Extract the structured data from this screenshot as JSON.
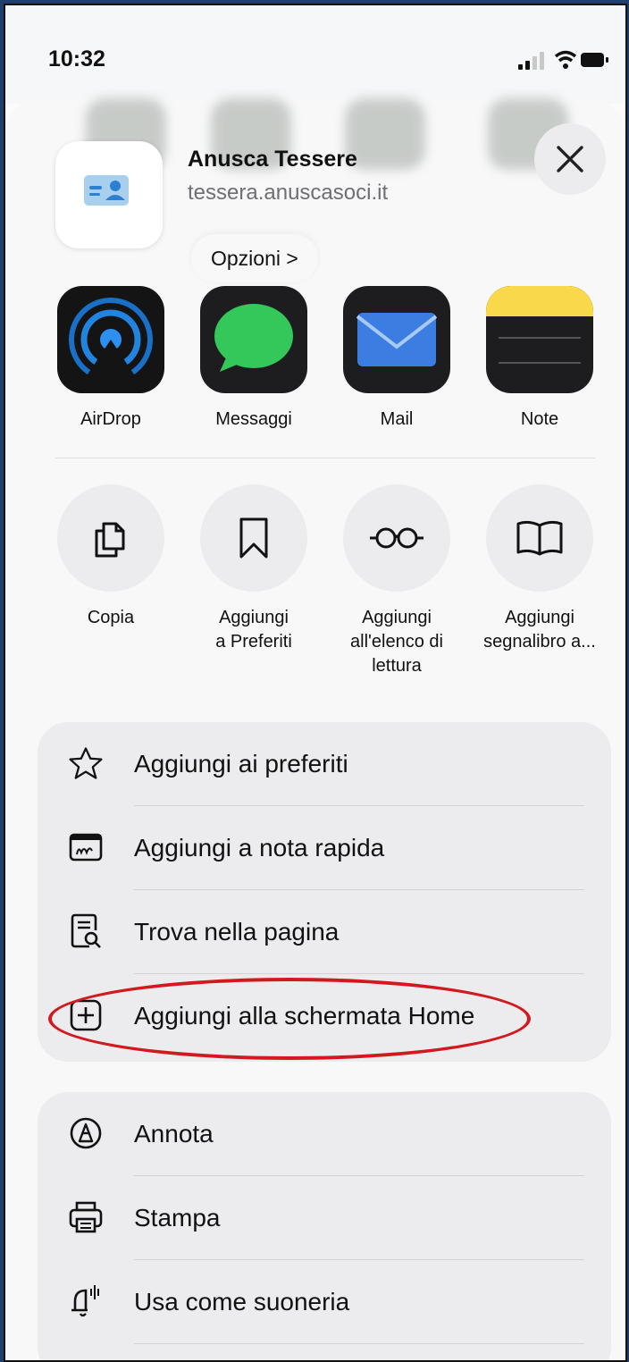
{
  "status_bar": {
    "time": "10:32"
  },
  "header": {
    "app_title": "Anusca Tessere",
    "app_url": "tessera.anuscasoci.it",
    "options_label": "Opzioni >"
  },
  "share_apps": [
    {
      "label": "AirDrop"
    },
    {
      "label": "Messaggi"
    },
    {
      "label": "Mail"
    },
    {
      "label": "Note"
    }
  ],
  "actions": [
    {
      "label": "Copia"
    },
    {
      "label": "Aggiungi a Preferiti"
    },
    {
      "label": "Aggiungi all'elenco di lettura"
    },
    {
      "label": "Aggiungi segnalibro a..."
    }
  ],
  "group1": [
    {
      "label": "Aggiungi ai preferiti",
      "icon": "star-icon"
    },
    {
      "label": "Aggiungi a nota rapida",
      "icon": "quick-note-icon"
    },
    {
      "label": "Trova nella pagina",
      "icon": "find-in-page-icon"
    },
    {
      "label": "Aggiungi alla schermata Home",
      "icon": "plus-square-icon"
    }
  ],
  "group2": [
    {
      "label": "Annota",
      "icon": "markup-icon"
    },
    {
      "label": "Stampa",
      "icon": "printer-icon"
    },
    {
      "label": "Usa come suoneria",
      "icon": "bell-icon"
    }
  ],
  "colors": {
    "highlight": "#d2191f",
    "messages_green": "#34c759",
    "airdrop_blue": "#1b7bd6"
  }
}
